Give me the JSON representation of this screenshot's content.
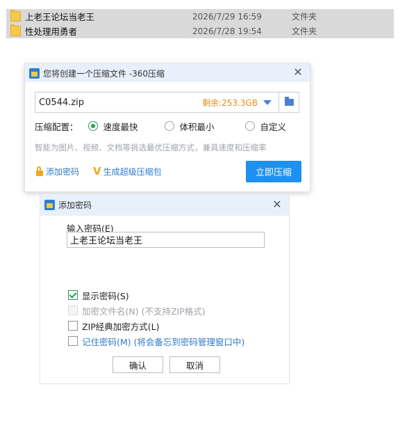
{
  "files": [
    {
      "name": "上老王论坛当老王",
      "date": "2026/7/29 16:59",
      "type": "文件夹"
    },
    {
      "name": "性处理用勇者",
      "date": "2026/7/28 19:54",
      "type": "文件夹"
    }
  ],
  "compress_dialog": {
    "title": "您将创建一个压缩文件 -360压缩",
    "filename": "C0544.zip",
    "free_space": "剩余:253.3GB",
    "config_label": "压缩配置：",
    "options": [
      "速度最快",
      "体积最小",
      "自定义"
    ],
    "selected_option": "速度最快",
    "hint": "智能为图片、视频、文档等挑选最优压缩方式，兼具速度和压缩率",
    "add_password": "添加密码",
    "super_compress": "生成超级压缩包",
    "compress_now": "立即压缩"
  },
  "password_dialog": {
    "title": "添加密码",
    "input_label": "输入密码(E)",
    "password_value": "上老王论坛当老王",
    "checkboxes": [
      {
        "label": "显示密码(S)",
        "checked": true,
        "enabled": true
      },
      {
        "label": "加密文件名(N) (不支持ZIP格式)",
        "checked": false,
        "enabled": false
      },
      {
        "label": "ZIP经典加密方式(L)",
        "checked": false,
        "enabled": true
      },
      {
        "label": "记住密码(M) (将会备忘到密码管理窗口中)",
        "checked": false,
        "enabled": true
      }
    ],
    "ok_label": "确认",
    "cancel_label": "取消"
  },
  "colors": {
    "accent": "#1e90f0",
    "link": "#2f7bc8",
    "free_space": "#e88a1a",
    "check": "#2a9d55"
  }
}
